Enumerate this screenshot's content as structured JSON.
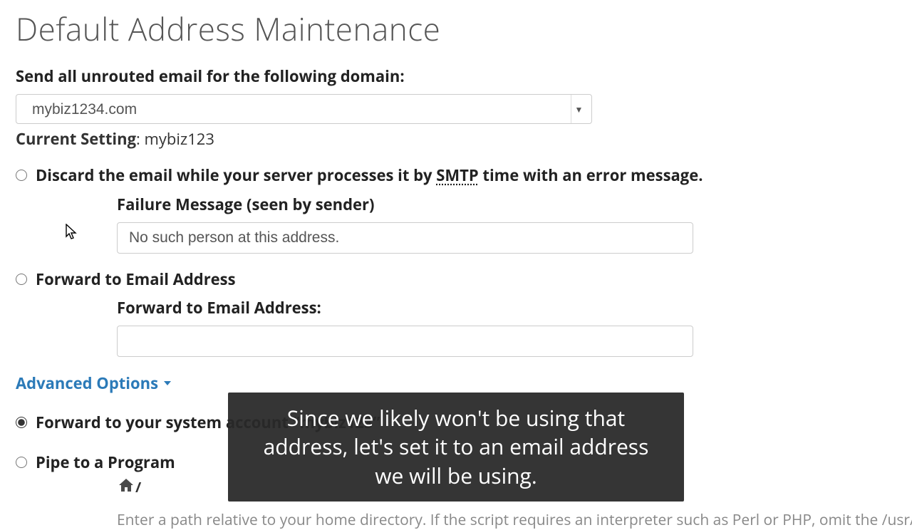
{
  "page": {
    "title": "Default Address Maintenance"
  },
  "domain": {
    "label": "Send all unrouted email for the following domain:",
    "selected": "mybiz1234.com"
  },
  "current_setting": {
    "label": "Current Setting",
    "value": "mybiz123"
  },
  "options": {
    "discard": {
      "label_pre": "Discard the email while your server processes it by ",
      "smtp": "SMTP",
      "label_post": " time with an error message.",
      "failure_label": "Failure Message (seen by sender)",
      "failure_value": "No such person at this address."
    },
    "forward_email": {
      "label": "Forward to Email Address",
      "field_label": "Forward to Email Address:",
      "value": ""
    },
    "advanced": {
      "label": "Advanced Options"
    },
    "system_account": {
      "label": "Forward to your system account “mybiz123”"
    },
    "pipe": {
      "label": "Pipe to a Program",
      "path_prefix": "/",
      "help": "Enter a path relative to your home directory. If the script requires an interpreter such as Perl or PHP, omit the /usr/bin/perl or"
    }
  },
  "caption": "Since we likely won't be using that address, let's set it to an email address we will be using."
}
